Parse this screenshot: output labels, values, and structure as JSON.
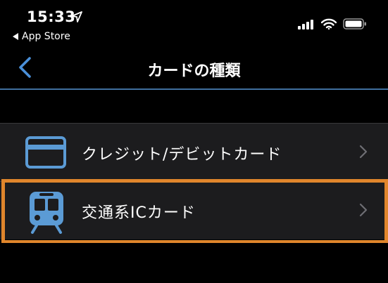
{
  "status_bar": {
    "time": "15:33",
    "back_app_label": "App Store",
    "location_icon": "location-arrow-icon",
    "signal_icon": "cellular-signal-icon",
    "wifi_icon": "wifi-icon",
    "battery_icon": "battery-icon"
  },
  "nav": {
    "title": "カードの種類",
    "back_icon": "chevron-left-icon"
  },
  "card_types": [
    {
      "label": "クレジット/デビットカード",
      "icon": "credit-card-icon"
    },
    {
      "label": "交通系ICカード",
      "icon": "train-icon",
      "highlighted": true
    }
  ],
  "colors": {
    "accent": "#4a90d9",
    "icon_blue": "#5b9bd5",
    "highlight": "#e0862c",
    "row_background": "#1c1c1e",
    "background": "#000000"
  }
}
